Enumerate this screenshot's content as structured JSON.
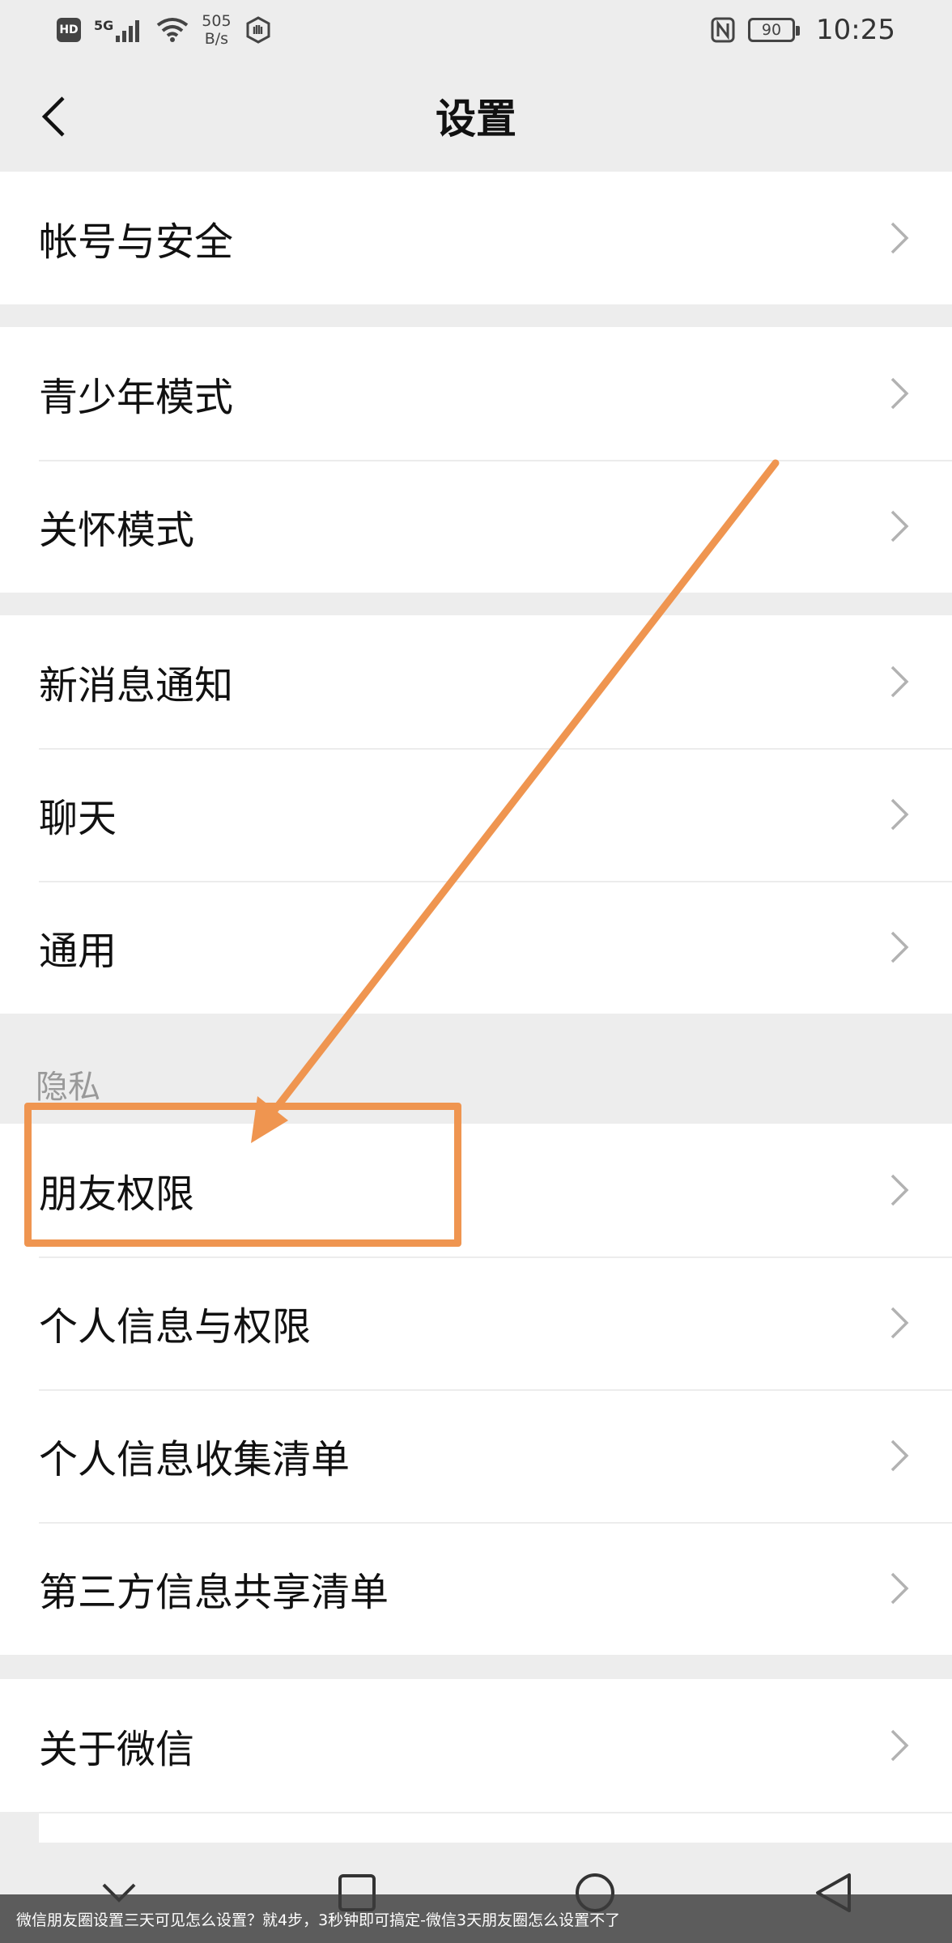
{
  "status_bar": {
    "hd": "HD",
    "signal": "5G",
    "speed_value": "505",
    "speed_unit": "B/s",
    "battery": "90",
    "time": "10:25"
  },
  "nav": {
    "title": "设置"
  },
  "groups": {
    "account": [
      "帐号与安全"
    ],
    "modes": [
      "青少年模式",
      "关怀模式"
    ],
    "general": [
      "新消息通知",
      "聊天",
      "通用"
    ],
    "privacy_header": "隐私",
    "privacy": [
      "朋友权限",
      "个人信息与权限",
      "个人信息收集清单",
      "第三方信息共享清单"
    ],
    "about": [
      "关于微信"
    ]
  },
  "caption": "微信朋友圈设置三天可见怎么设置？就4步，3秒钟即可搞定-微信3天朋友圈怎么设置不了",
  "colors": {
    "annotation": "#ef9550",
    "background": "#ededed",
    "card": "#ffffff"
  }
}
